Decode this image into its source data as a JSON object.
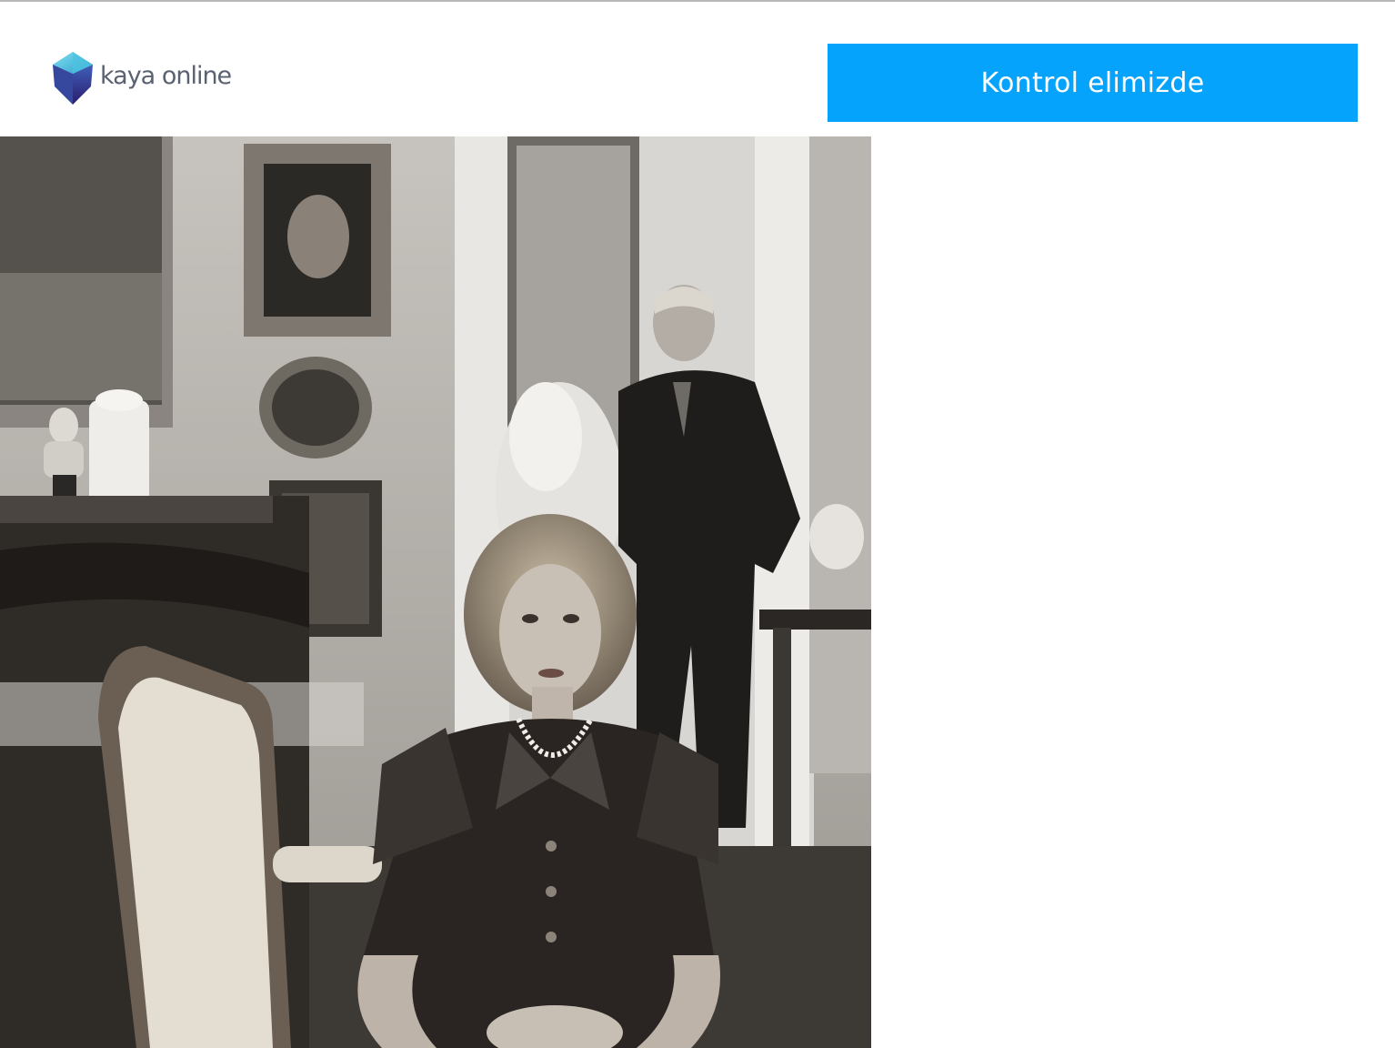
{
  "header": {
    "logo_text": "kaya online",
    "cta_label": "Kontrol elimizde"
  },
  "colors": {
    "accent": "#06a3fc",
    "logo_text": "#5a6170",
    "logo_gem_top": "#55c6e3",
    "logo_gem_bottom": "#3a2b8a"
  },
  "hero": {
    "image": "sepia-portrait-woman-seated-man-standing"
  }
}
